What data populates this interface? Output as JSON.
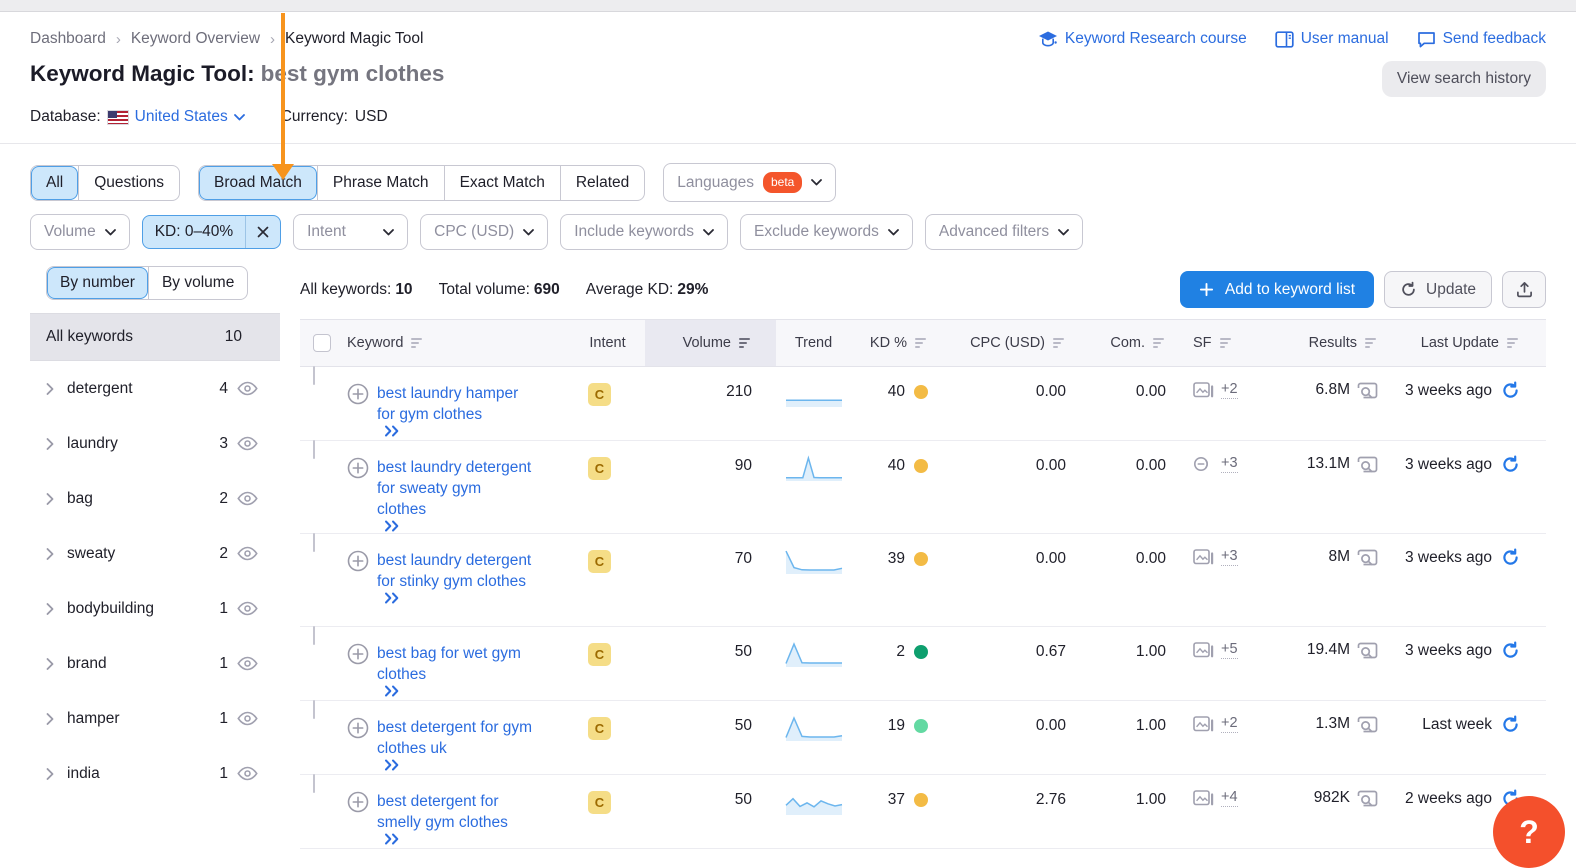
{
  "breadcrumb": {
    "items": [
      "Dashboard",
      "Keyword Overview",
      "Keyword Magic Tool"
    ],
    "separator": "›"
  },
  "header_links": [
    {
      "label": "Keyword Research course",
      "icon": "graduation-cap-icon"
    },
    {
      "label": "User manual",
      "icon": "book-icon"
    },
    {
      "label": "Send feedback",
      "icon": "chat-bubble-icon"
    }
  ],
  "title": {
    "prefix": "Keyword Magic Tool:",
    "query": "best gym clothes"
  },
  "view_search_history_label": "View search history",
  "database_row": {
    "database_label": "Database:",
    "database_value": "United States",
    "currency_label": "Currency:",
    "currency_value": "USD"
  },
  "match_tabs": {
    "group1": [
      "All",
      "Questions"
    ],
    "group2": [
      "Broad Match",
      "Phrase Match",
      "Exact Match",
      "Related"
    ],
    "selected": [
      "All",
      "Broad Match"
    ],
    "languages_label": "Languages",
    "languages_badge": "beta"
  },
  "filters": {
    "volume": "Volume",
    "kd": "KD: 0–40%",
    "intent": "Intent",
    "cpc": "CPC (USD)",
    "include": "Include keywords",
    "exclude": "Exclude keywords",
    "advanced": "Advanced filters"
  },
  "sidebar": {
    "toggle": {
      "by_number": "By number",
      "by_volume": "By volume",
      "selected": "By number"
    },
    "all_keywords_label": "All keywords",
    "all_keywords_count": "10",
    "groups": [
      {
        "label": "detergent",
        "count": "4"
      },
      {
        "label": "laundry",
        "count": "3"
      },
      {
        "label": "bag",
        "count": "2"
      },
      {
        "label": "sweaty",
        "count": "2"
      },
      {
        "label": "bodybuilding",
        "count": "1"
      },
      {
        "label": "brand",
        "count": "1"
      },
      {
        "label": "hamper",
        "count": "1"
      },
      {
        "label": "india",
        "count": "1"
      }
    ]
  },
  "stats": {
    "all_keywords_label": "All keywords:",
    "all_keywords_value": "10",
    "total_volume_label": "Total volume:",
    "total_volume_value": "690",
    "avg_kd_label": "Average KD:",
    "avg_kd_value": "29%"
  },
  "actions": {
    "add_to_list": "Add to keyword list",
    "update": "Update"
  },
  "table": {
    "columns": [
      "Keyword",
      "Intent",
      "Volume",
      "Trend",
      "KD %",
      "CPC (USD)",
      "Com.",
      "SF",
      "Results",
      "Last Update"
    ],
    "rows": [
      {
        "keyword": "best laundry hamper for gym clothes",
        "intent": "C",
        "volume": "210",
        "trend": [
          2.2,
          2.2,
          2.2,
          2.2,
          2.2,
          2.2,
          2.2,
          2.2
        ],
        "kd": "40",
        "kd_level": "amber",
        "cpc": "0.00",
        "com": "0.00",
        "sf_icon": "image",
        "sf_more": "+2",
        "results": "6.8M",
        "last_update": "3 weeks ago"
      },
      {
        "keyword": "best laundry detergent for sweaty gym clothes",
        "intent": "C",
        "volume": "90",
        "trend": [
          0.6,
          0.6,
          0.6,
          0.6,
          9.5,
          0.7,
          0.6,
          0.6,
          0.6,
          0.6,
          0.6
        ],
        "kd": "40",
        "kd_level": "amber",
        "cpc": "0.00",
        "com": "0.00",
        "sf_icon": "link",
        "sf_more": "+3",
        "results": "13.1M",
        "last_update": "3 weeks ago"
      },
      {
        "keyword": "best laundry detergent for stinky gym clothes",
        "intent": "C",
        "volume": "70",
        "trend": [
          9.5,
          2.0,
          1.0,
          0.9,
          0.9,
          0.9,
          0.9,
          1.7
        ],
        "kd": "39",
        "kd_level": "amber",
        "cpc": "0.00",
        "com": "0.00",
        "sf_icon": "image",
        "sf_more": "+3",
        "results": "8M",
        "last_update": "3 weeks ago"
      },
      {
        "keyword": "best bag for wet gym clothes",
        "intent": "C",
        "volume": "50",
        "trend": [
          0.7,
          9.5,
          1.0,
          0.9,
          0.9,
          0.9,
          0.9,
          0.9
        ],
        "kd": "2",
        "kd_level": "green",
        "cpc": "0.67",
        "com": "1.00",
        "sf_icon": "image",
        "sf_more": "+5",
        "results": "19.4M",
        "last_update": "3 weeks ago"
      },
      {
        "keyword": "best detergent for gym clothes uk",
        "intent": "C",
        "volume": "50",
        "trend": [
          0.7,
          9.5,
          1.2,
          0.9,
          0.9,
          0.9,
          0.9,
          1.5
        ],
        "kd": "19",
        "kd_level": "green-light",
        "cpc": "0.00",
        "com": "1.00",
        "sf_icon": "image",
        "sf_more": "+2",
        "results": "1.3M",
        "last_update": "Last week"
      },
      {
        "keyword": "best detergent for smelly gym clothes",
        "intent": "C",
        "volume": "50",
        "trend": [
          3.5,
          6.5,
          3.0,
          4.6,
          2.8,
          5.5,
          4.2,
          3.2,
          3.8
        ],
        "kd": "37",
        "kd_level": "amber",
        "cpc": "2.76",
        "com": "1.00",
        "sf_icon": "image",
        "sf_more": "+4",
        "results": "982K",
        "last_update": "2 weeks ago"
      }
    ]
  },
  "help_button_label": "?",
  "colors": {
    "link_blue": "#2b6cdf",
    "primary_button": "#2081e3",
    "selected_tab_bg": "#cde7fb",
    "selected_tab_border": "#4f9fe6",
    "arrow_orange": "#f7941d",
    "help_orange": "#f4502c",
    "beta_badge": "#f4552b",
    "kd_amber": "#f3bb45",
    "kd_green": "#0e9f6e",
    "kd_green_light": "#63d9a2",
    "intent_badge_bg": "#f5dd87",
    "intent_badge_text": "#9c6a00",
    "trend_line": "#6cb6ee"
  }
}
